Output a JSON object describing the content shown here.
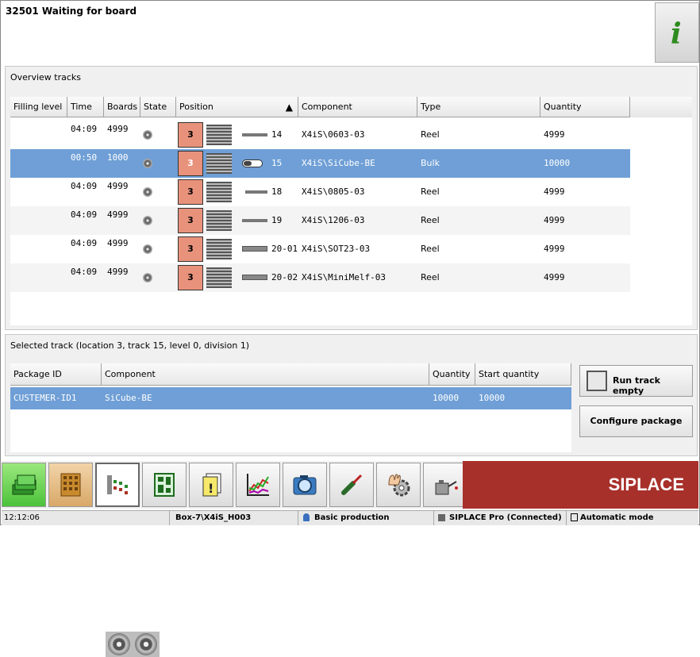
{
  "header": {
    "title": "32501 Waiting for board"
  },
  "overview": {
    "title": "Overview tracks",
    "columns": [
      "Filling level",
      "Time",
      "Boards",
      "State",
      "Position",
      "Component",
      "Type",
      "Quantity"
    ],
    "sort_indicator": "▲",
    "rows": [
      {
        "filling": "",
        "time": "04:09",
        "boards": "4999",
        "state_icon": "reel-state-icon",
        "location": "3",
        "track": "14",
        "component": "X4iS\\0603-03",
        "type": "Reel",
        "quantity": "4999",
        "selected": false
      },
      {
        "filling": "",
        "time": "00:50",
        "boards": "1000",
        "state_icon": "reel-state-icon",
        "location": "3",
        "track": "15",
        "component": "X4iS\\SiCube-BE",
        "type": "Bulk",
        "quantity": "10000",
        "selected": true
      },
      {
        "filling": "",
        "time": "04:09",
        "boards": "4999",
        "state_icon": "reel-state-icon",
        "location": "3",
        "track": "18",
        "component": "X4iS\\0805-03",
        "type": "Reel",
        "quantity": "4999",
        "selected": false
      },
      {
        "filling": "",
        "time": "04:09",
        "boards": "4999",
        "state_icon": "reel-state-icon",
        "location": "3",
        "track": "19",
        "component": "X4iS\\1206-03",
        "type": "Reel",
        "quantity": "4999",
        "selected": false
      },
      {
        "filling": "",
        "time": "04:09",
        "boards": "4999",
        "state_icon": "reel-state-icon",
        "location": "3",
        "track": "20-01",
        "component": "X4iS\\SOT23-03",
        "type": "Reel",
        "quantity": "4999",
        "selected": false
      },
      {
        "filling": "",
        "time": "04:09",
        "boards": "4999",
        "state_icon": "reel-state-icon",
        "location": "3",
        "track": "20-02",
        "component": "X4iS\\MiniMelf-03",
        "type": "Reel",
        "quantity": "4999",
        "selected": false
      }
    ]
  },
  "selected_track": {
    "title": "Selected track (location 3, track 15, level 0, division 1)",
    "columns": [
      "Package ID",
      "Component",
      "Quantity",
      "Start quantity"
    ],
    "rows": [
      {
        "package_id": "CUSTEMER-ID1",
        "component": "SiCube-BE",
        "quantity": "10000",
        "start_quantity": "10000"
      }
    ],
    "run_track_empty_label": "Run track empty",
    "configure_package_label": "Configure package"
  },
  "toolbar": {
    "items": [
      "money-stack-icon",
      "grid-board-icon",
      "track-view-icon",
      "board-layout-icon",
      "documents-warning-icon",
      "trend-chart-icon",
      "camera-icon",
      "screwdriver-icon",
      "hand-gear-icon",
      "oil-can-icon"
    ],
    "brand": "SIPLACE"
  },
  "status_bar": {
    "time": "12:12:06",
    "station": "Box-7\\X4iS_H003",
    "production": "Basic production",
    "connection": "SIPLACE Pro (Connected)",
    "mode": "Automatic mode"
  },
  "colors": {
    "selected_row": "#6f9fd6",
    "brand_red": "#a8302a",
    "position_box": "#e8927c"
  }
}
